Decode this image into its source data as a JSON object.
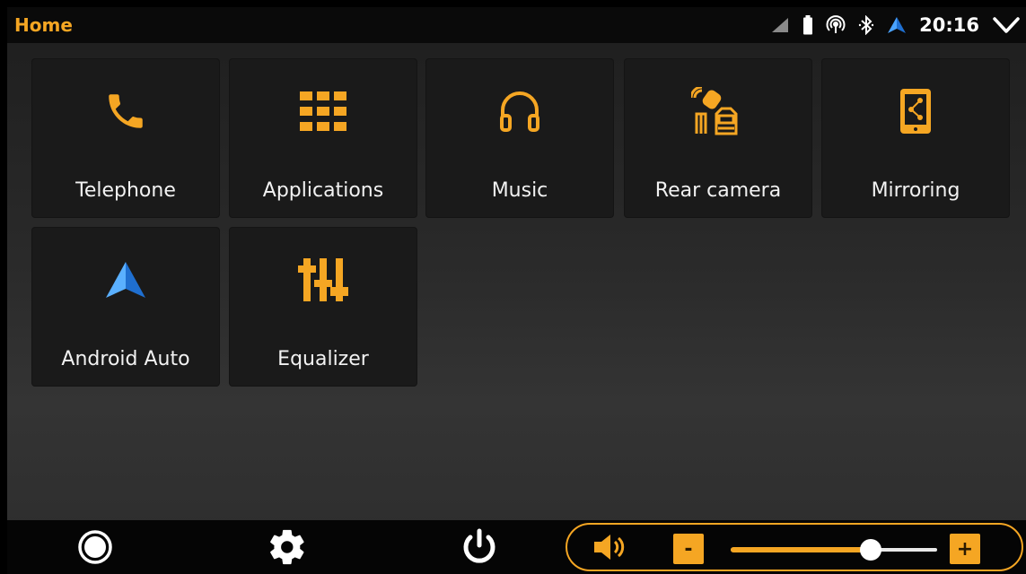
{
  "statusbar": {
    "title": "Home",
    "time": "20:16",
    "icons": [
      "cell-signal-icon",
      "battery-icon",
      "hotspot-icon",
      "bluetooth-icon",
      "android-auto-status-icon",
      "chevron-down-icon"
    ]
  },
  "tiles": [
    {
      "label": "Telephone",
      "icon": "phone-icon"
    },
    {
      "label": "Applications",
      "icon": "grid-icon"
    },
    {
      "label": "Music",
      "icon": "headphones-icon"
    },
    {
      "label": "Rear camera",
      "icon": "rear-camera-icon"
    },
    {
      "label": "Mirroring",
      "icon": "mirroring-icon"
    },
    {
      "label": "Android Auto",
      "icon": "android-auto-icon"
    },
    {
      "label": "Equalizer",
      "icon": "equalizer-icon"
    }
  ],
  "bottombar": {
    "icons": [
      "home-circle-icon",
      "settings-gear-icon",
      "power-icon",
      "speaker-icon"
    ],
    "volume_minus": "-",
    "volume_plus": "+",
    "volume_level": 0.68
  },
  "colors": {
    "accent": "#f5a623",
    "android_auto_blue": "#2f8ff0"
  }
}
